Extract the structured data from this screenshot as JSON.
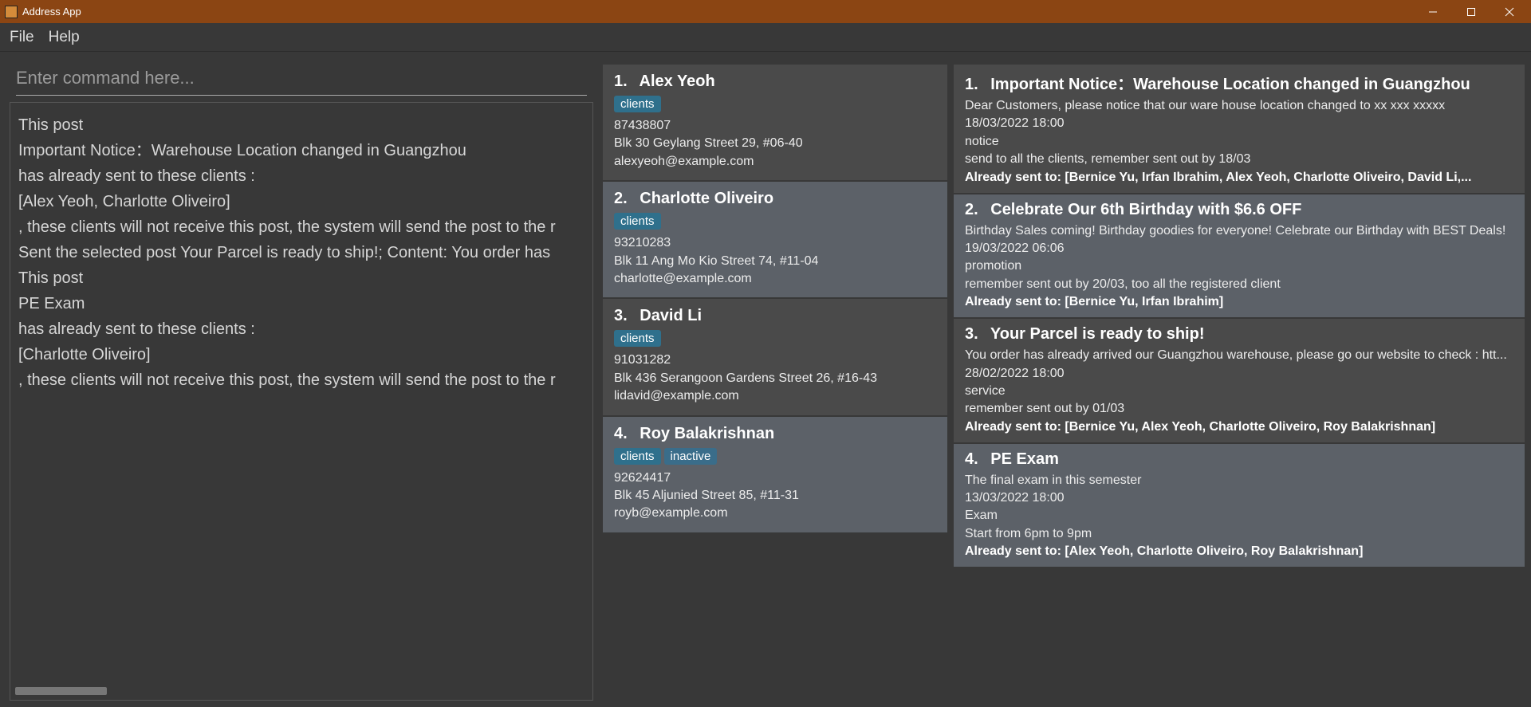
{
  "window": {
    "title": "Address App"
  },
  "menu": {
    "file": "File",
    "help": "Help"
  },
  "command": {
    "placeholder": "Enter command here..."
  },
  "result": {
    "lines": [
      "This post",
      "Important Notice：Warehouse Location changed in Guangzhou",
      " has already sent to these clients :",
      "[Alex Yeoh, Charlotte Oliveiro]",
      ", these clients will not receive this post, the system will send the post to the r",
      "Sent the selected post Your Parcel is ready to ship!; Content: You order has",
      "This post",
      "PE Exam",
      " has already sent to these clients :",
      "[Charlotte Oliveiro]",
      ", these clients will not receive this post, the system will send the post to the r"
    ]
  },
  "clients": [
    {
      "num": "1.",
      "name": "Alex Yeoh",
      "tags": [
        "clients"
      ],
      "phone": "87438807",
      "address": "Blk 30 Geylang Street 29, #06-40",
      "email": "alexyeoh@example.com"
    },
    {
      "num": "2.",
      "name": "Charlotte Oliveiro",
      "tags": [
        "clients"
      ],
      "phone": "93210283",
      "address": "Blk 11 Ang Mo Kio Street 74, #11-04",
      "email": "charlotte@example.com"
    },
    {
      "num": "3.",
      "name": "David Li",
      "tags": [
        "clients"
      ],
      "phone": "91031282",
      "address": "Blk 436 Serangoon Gardens Street 26, #16-43",
      "email": "lidavid@example.com"
    },
    {
      "num": "4.",
      "name": "Roy Balakrishnan",
      "tags": [
        "clients",
        "inactive"
      ],
      "phone": "92624417",
      "address": "Blk 45 Aljunied Street 85, #11-31",
      "email": "royb@example.com"
    }
  ],
  "notices": [
    {
      "num": "1.",
      "title": "Important Notice：Warehouse Location changed in Guangzhou",
      "body": "Dear Customers, please notice that our ware house location changed to xx xxx xxxxx",
      "date": "18/03/2022 18:00",
      "category": "notice",
      "note": "send to all the clients, remember sent out by 18/03",
      "sent": "Already sent to: [Bernice Yu, Irfan Ibrahim, Alex Yeoh, Charlotte Oliveiro, David Li,..."
    },
    {
      "num": "2.",
      "title": "Celebrate Our 6th Birthday with $6.6 OFF",
      "body": "Birthday Sales coming! Birthday goodies for everyone! Celebrate our Birthday with BEST Deals!",
      "date": "19/03/2022 06:06",
      "category": "promotion",
      "note": "remember sent out by 20/03, too all the registered client",
      "sent": "Already sent to: [Bernice Yu, Irfan Ibrahim]"
    },
    {
      "num": "3.",
      "title": "Your Parcel is ready to ship!",
      "body": "You order has already arrived our Guangzhou warehouse, please go our website to check : htt...",
      "date": "28/02/2022 18:00",
      "category": "service",
      "note": "remember sent out by 01/03",
      "sent": "Already sent to: [Bernice Yu, Alex Yeoh, Charlotte Oliveiro, Roy Balakrishnan]"
    },
    {
      "num": "4.",
      "title": "PE Exam",
      "body": "The final exam in this semester",
      "date": "13/03/2022 18:00",
      "category": "Exam",
      "note": "Start from 6pm to 9pm",
      "sent": "Already sent to: [Alex Yeoh, Charlotte Oliveiro, Roy Balakrishnan]"
    }
  ]
}
